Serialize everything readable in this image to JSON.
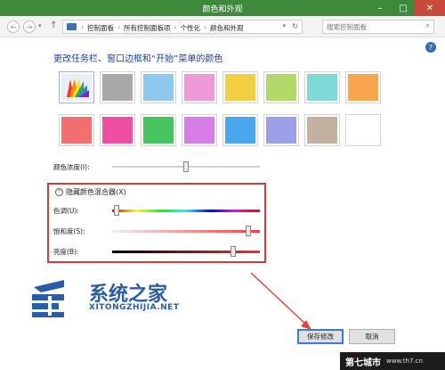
{
  "window": {
    "title": "颜色和外观"
  },
  "address": {
    "crumbs": [
      "控制面板",
      "所有控制面板项",
      "个性化",
      "颜色和外观"
    ],
    "search_placeholder": "搜索控制面板"
  },
  "heading": "更改任务栏、窗口边框和“开始”菜单的颜色",
  "swatches": {
    "row1": [
      "auto",
      "#a9a9a9",
      "#8ec8f0",
      "#ee9ad6",
      "#f2cf40",
      "#b3d96a",
      "#7fd9d4",
      "#f9a54c"
    ],
    "row2": [
      "#f36f6f",
      "#ef4fa0",
      "#45c45f",
      "#d67de8",
      "#4aa7ee",
      "#9b9fe6",
      "#c2b1a0",
      "#ffffff"
    ]
  },
  "color_intensity": {
    "label": "颜色浓度(I):",
    "value": 0.5
  },
  "mixer": {
    "toggle_label": "隐藏颜色混合器(X)",
    "hue_label": "色调(U):",
    "hue_value": 0.03,
    "saturation_label": "饱和度(S):",
    "saturation_value": 0.92,
    "brightness_label": "亮度(B):",
    "brightness_value": 0.82
  },
  "watermark": {
    "title": "系统之家",
    "subtitle": "XITONGZHIJIA.NET"
  },
  "buttons": {
    "save": "保存修改",
    "cancel": "取消"
  },
  "brand": {
    "name": "第七城市",
    "url": "www.th7.cn"
  },
  "colors": {
    "titlebar": "#3c8a3a",
    "heading": "#1f3f9a",
    "highlight_box": "#d23a3a",
    "watermark": "#2a5da8"
  }
}
